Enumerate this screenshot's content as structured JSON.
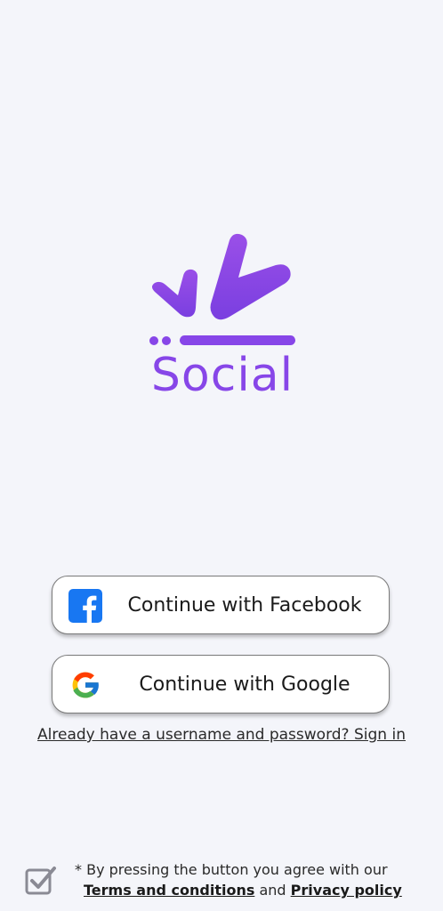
{
  "brand": {
    "name": "Social",
    "color": "#8746e8"
  },
  "buttons": {
    "facebook_label": "Continue with Facebook",
    "google_label": "Continue with Google"
  },
  "signin": {
    "text": "Already have a username and password? Sign in"
  },
  "agreement": {
    "prefix": "* By pressing the button you agree with our",
    "terms_label": "Terms and conditions",
    "and_text": "and",
    "privacy_label": "Privacy policy",
    "checked": true
  },
  "icons": {
    "facebook": "facebook-icon",
    "google": "google-icon",
    "checkbox": "checkbox-checked-icon"
  },
  "colors": {
    "background": "#f4f5fa",
    "facebook_blue": "#1877f2",
    "logo_purple": "#8746e8"
  }
}
